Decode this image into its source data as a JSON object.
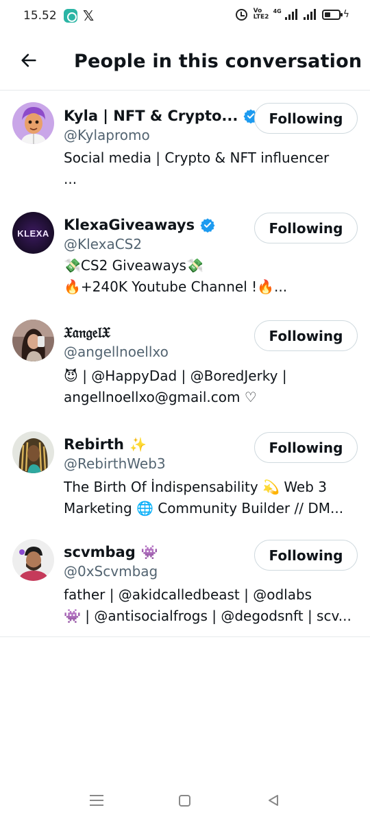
{
  "status_bar": {
    "time": "15.52",
    "network": "4G",
    "volte_top": "Vo",
    "volte_bottom": "LTE2"
  },
  "header": {
    "title": "People in this conversation"
  },
  "users": [
    {
      "name": "Kyla | NFT & Crypto...",
      "verified": true,
      "handle": "@Kylapromo",
      "bio_line1": "Social media | Crypto & NFT influencer",
      "bio_line2": "...",
      "button": "Following"
    },
    {
      "name": "KlexaGiveaways",
      "verified": true,
      "avatar_text": "KLEXA",
      "handle": "@KlexaCS2",
      "bio_line1": "💸CS2 Giveaways💸",
      "bio_line2": "🔥+240K Youtube Channel !🔥...",
      "button": "Following"
    },
    {
      "name": "𝔛𝔞𝔫𝔤𝔢𝔩𝔛",
      "verified": false,
      "handle": "@angellnoellxo",
      "bio_line1": "😈 | @HappyDad | @BoredJerky |",
      "bio_line2": "angellnoellxo@gmail.com ♡",
      "button": "Following"
    },
    {
      "name": "Rebirth",
      "name_emoji": "✨",
      "verified": false,
      "handle": "@RebirthWeb3",
      "bio_line1": "The Birth Of İndispensability 💫  Web 3",
      "bio_line2": "Marketing 🌐 Community Builder // DM...",
      "button": "Following"
    },
    {
      "name": "scvmbag",
      "name_emoji": "👾",
      "verified": false,
      "handle": "@0xScvmbag",
      "bio_line1": "father | @akidcalledbeast | @odlabs",
      "bio_line2": "👾 | @antisocialfrogs | @degodsnft | scv...",
      "button": "Following"
    }
  ],
  "colors": {
    "verified": "#1d9bf0",
    "handle": "#536471",
    "divider": "#e6e9eb",
    "button_border": "#cfd9de"
  },
  "icons": {
    "back": "arrow-left-icon",
    "verified": "verified-badge-icon",
    "nav_menu": "recents-icon",
    "nav_home": "home-square-icon",
    "nav_back": "back-triangle-icon"
  }
}
